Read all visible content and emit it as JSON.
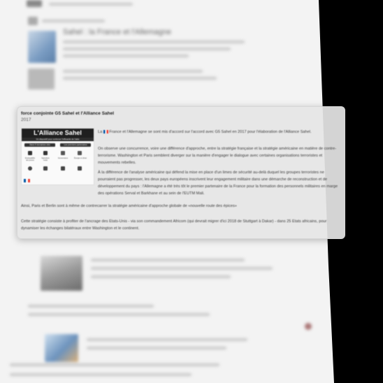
{
  "background": {
    "results": [
      {
        "title": "Sahel : la France et l'Allemagne",
        "color": "#7a9cc2"
      },
      {
        "title": "G5 Sahel"
      },
      {
        "title": ""
      },
      {
        "title": ""
      }
    ]
  },
  "popup": {
    "title": "force conjointe G5 Sahel et l'Alliance Sahel",
    "year": "2017",
    "infographic": {
      "heading": "L'Alliance Sahel",
      "subheading": "Un dispositif pour renforcer l'efficacité de l'aide",
      "tab_left": "Dans 5 domaines clés",
      "tab_right": "Les premiers partenaires",
      "icons": [
        "people-icon",
        "briefcase-icon",
        "scale-icon",
        "energy-icon"
      ],
      "labels": [
        "Employabilité des jeunes",
        "Agriculture rurale",
        "Gouvernance",
        "Énergie et climat"
      ]
    },
    "paragraphs": [
      {
        "pre": "La ",
        "text": " France et l'Allemagne se sont mis d'accord sur l'accord avec G5 Sahel en 2017 pour l'élaboration de l'Alliance Sahel."
      },
      {
        "text": "On observe une concurrence, voire une différence d'approche, entre la stratégie française et la stratégie américaine en matière de contre-terrorisme. Washington et Paris semblent diverger sur la manière d'engager le dialogue avec certaines organisations terroristes et mouvements rebelles."
      },
      {
        "text": "À la différence de l'analyse américaine qui défend la mise en place d'un limes de sécurité au-delà duquel les groupes terroristes ne pourraient pas progresser, les deux pays européens inscrivent leur engagement militaire dans une démarche de reconstruction et de développement du pays : l'Allemagne a été très tôt le premier partenaire de la France pour la formation des personnels militaires en marge des opérations Serval et Barkhane et au sein de l'EUTM Mali."
      },
      {
        "text": "Ainsi, Paris et Berlin sont à même de contrecarrer la stratégie américaine d'approche globale de «nouvelle route des épices»"
      },
      {
        "text": "Cette stratégie consiste à profiter de l'ancrage des Etats-Unis - via son commandement Africom (qui devrait migrer d'ici 2018 de Stuttgart à Dakar) - dans 25 Etats africains, pour dynamiser les échanges bilatéraux entre Washington et le continent."
      }
    ]
  }
}
